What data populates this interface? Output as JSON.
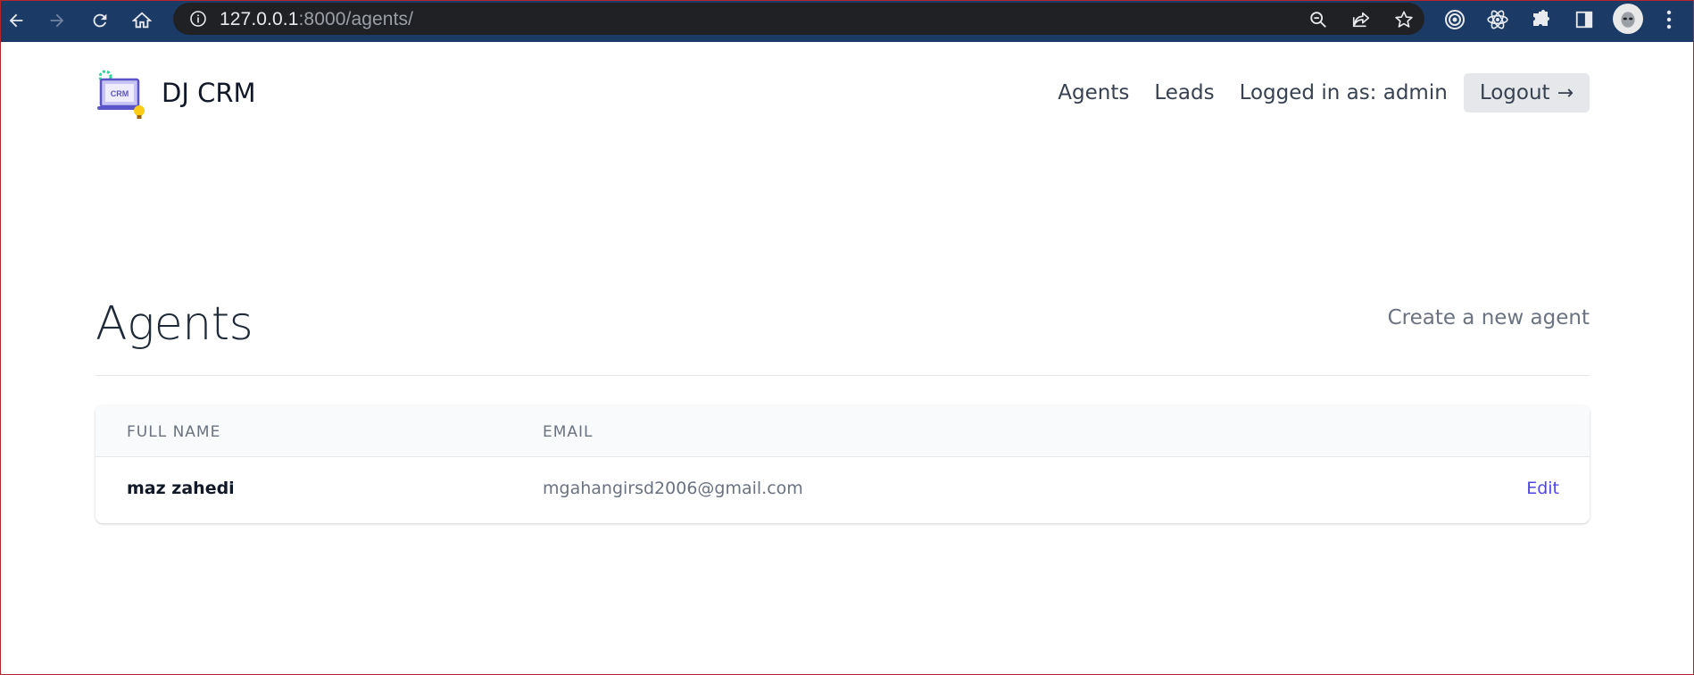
{
  "browser": {
    "url_host": "127.0.0.1",
    "url_rest": ":8000/agents/"
  },
  "header": {
    "brand": "DJ CRM",
    "logo_text": "CRM",
    "nav": {
      "agents": "Agents",
      "leads": "Leads",
      "logged_in": "Logged in as: admin",
      "logout": "Logout",
      "logout_arrow": "→"
    }
  },
  "main": {
    "title": "Agents",
    "create_link": "Create a new agent",
    "table": {
      "columns": [
        "FULL NAME",
        "EMAIL"
      ],
      "rows": [
        {
          "name": "maz zahedi",
          "email": "mgahangirsd2006@gmail.com",
          "action": "Edit"
        }
      ]
    }
  },
  "colors": {
    "chrome_bg": "#1b3b66",
    "omnibox_bg": "#202124",
    "link_accent": "#4f46e5",
    "button_bg": "#e5e7eb"
  }
}
